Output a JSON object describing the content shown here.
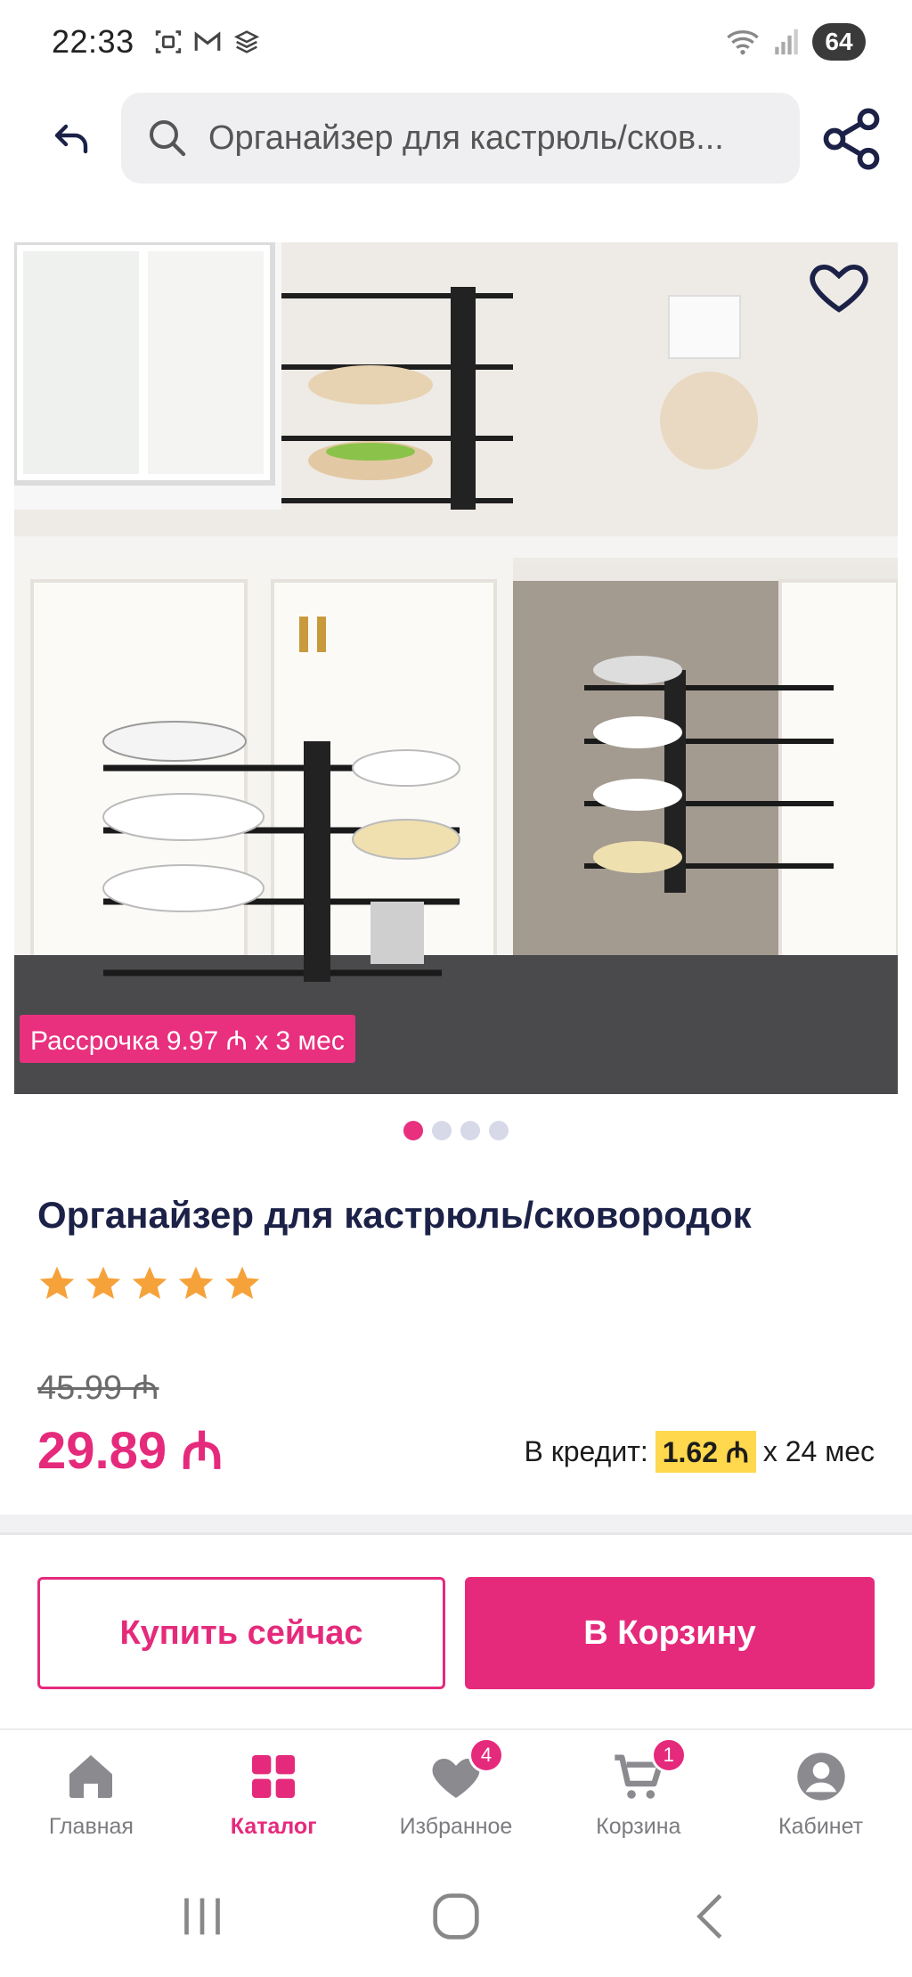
{
  "status_bar": {
    "time": "22:33",
    "battery": "64",
    "icons": [
      "screenshot-icon",
      "gmail-icon",
      "stack-icon",
      "wifi-icon",
      "signal-icon"
    ]
  },
  "search": {
    "query": "Органайзер для кастрюль/сков..."
  },
  "gallery": {
    "installment_badge": "Рассрочка 9.97 ₼ x 3 мес",
    "dots_count": 4,
    "active_dot": 1
  },
  "product": {
    "title": "Органайзер для кастрюль/сковородок",
    "rating": 5,
    "old_price": "45.99 ₼",
    "price": "29.89 ₼",
    "credit_label": "В кредит:",
    "credit_amount": "1.62 ₼",
    "credit_term": "x 24 мес"
  },
  "actions": {
    "buy_now": "Купить сейчас",
    "add_to_cart": "В Корзину"
  },
  "bottom_nav": {
    "items": [
      {
        "label": "Главная",
        "icon": "home-icon"
      },
      {
        "label": "Каталог",
        "icon": "catalog-icon",
        "active": true
      },
      {
        "label": "Избранное",
        "icon": "heart-icon",
        "badge": "4"
      },
      {
        "label": "Корзина",
        "icon": "cart-icon",
        "badge": "1"
      },
      {
        "label": "Кабинет",
        "icon": "profile-icon"
      }
    ]
  },
  "colors": {
    "accent": "#e52a7c",
    "title": "#1c2147",
    "star": "#f6a23a",
    "credit_highlight": "#ffd84d"
  }
}
